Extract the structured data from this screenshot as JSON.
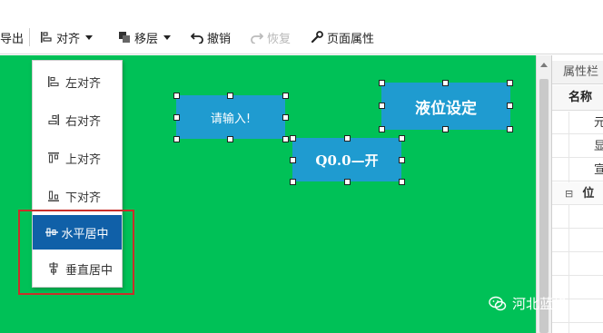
{
  "toolbar": {
    "export_label": "导出",
    "align_label": "对齐",
    "move_layer_label": "移层",
    "undo_label": "撤销",
    "redo_label": "恢复",
    "page_props_label": "页面属性"
  },
  "align_menu": {
    "items": [
      {
        "label": "左对齐",
        "icon": "align-left-icon"
      },
      {
        "label": "右对齐",
        "icon": "align-right-icon"
      },
      {
        "label": "上对齐",
        "icon": "align-top-icon"
      },
      {
        "label": "下对齐",
        "icon": "align-bottom-icon"
      },
      {
        "label": "水平居中",
        "icon": "align-horizontal-center-icon",
        "active": true
      },
      {
        "label": "垂直居中",
        "icon": "align-vertical-center-icon"
      }
    ]
  },
  "canvas": {
    "background": "#00c157",
    "widgets": {
      "input": {
        "label": "请输入!"
      },
      "level_setting": {
        "label": "液位设定"
      },
      "q0_button": {
        "label": "Q0.0—开"
      }
    }
  },
  "properties": {
    "title": "属性栏",
    "name_col": "名称",
    "rows": [
      "元",
      "显",
      "宣",
      "位"
    ],
    "position_group_label": "位",
    "expand_symbol": "⊟"
  },
  "watermark": {
    "text": "河北蓝蜂"
  },
  "colors": {
    "accent": "#1060a8",
    "widget": "#1f9bd0",
    "highlight": "#c8302a"
  }
}
